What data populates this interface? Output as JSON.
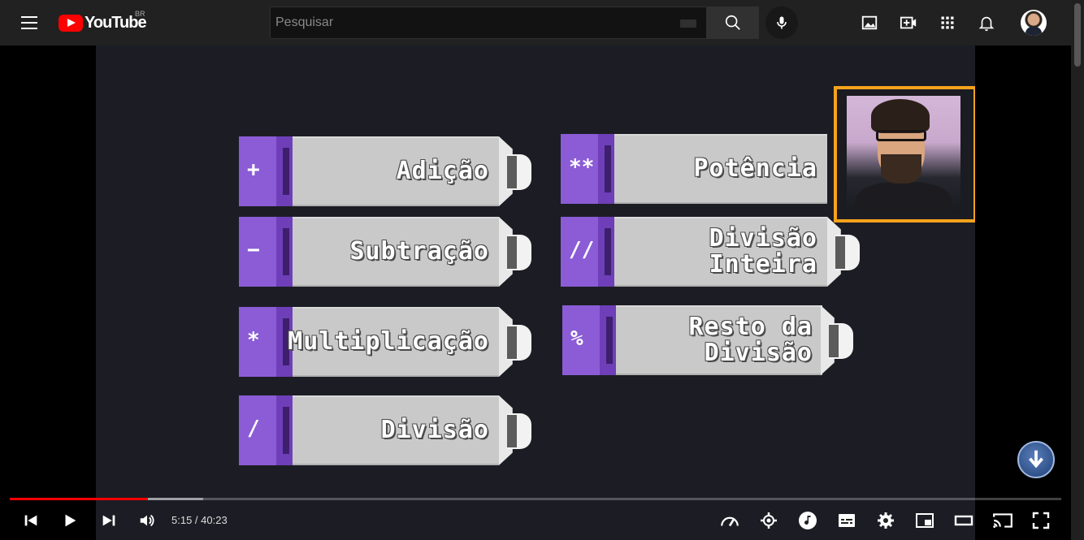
{
  "header": {
    "logo_text": "YouTube",
    "country_code": "BR",
    "search_placeholder": "Pesquisar",
    "icons": [
      "menu-icon",
      "search-icon",
      "mic-icon",
      "create-icon",
      "add-video-icon",
      "apps-icon",
      "bell-icon"
    ]
  },
  "video": {
    "blocks": [
      {
        "symbol": "+",
        "label": "Adição"
      },
      {
        "symbol": "−",
        "label": "Subtração"
      },
      {
        "symbol": "*",
        "label": "Multiplicação"
      },
      {
        "symbol": "/",
        "label": "Divisão"
      },
      {
        "symbol": "**",
        "label": "Potência"
      },
      {
        "symbol": "//",
        "label": "Divisão Inteira"
      },
      {
        "symbol": "%",
        "label": "Resto da Divisão"
      }
    ]
  },
  "player": {
    "time_current": "5:15",
    "time_total": "40:23",
    "played_fraction": 0.131,
    "buffered_fraction": 0.184
  },
  "colors": {
    "brand": "#ff0000",
    "block_purple": "#8b5cd6",
    "cam_border": "#f5a21c"
  }
}
